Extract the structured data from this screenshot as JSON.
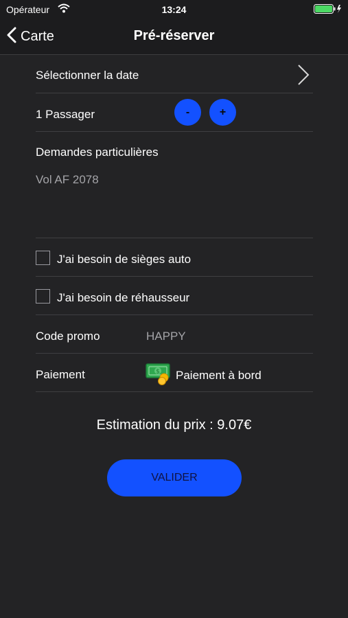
{
  "status_bar": {
    "carrier": "Opérateur",
    "time": "13:24"
  },
  "nav": {
    "back_label": "Carte",
    "title": "Pré-réserver"
  },
  "form": {
    "date_label": "Sélectionner la date",
    "passenger_label": "1 Passager",
    "minus_label": "-",
    "plus_label": "+",
    "requests_label": "Demandes particulières",
    "requests_text": "Vol AF 2078",
    "car_seats_label": "J'ai besoin de sièges auto",
    "car_seats_checked": false,
    "booster_label": "J'ai besoin de réhausseur",
    "booster_checked": false,
    "promo_label": "Code promo",
    "promo_value": "HAPPY",
    "payment_label": "Paiement",
    "payment_value": "Paiement à bord"
  },
  "estimate_text": "Estimation du prix : 9.07€",
  "validate_label": "VALIDER",
  "colors": {
    "background": "#232325",
    "accent": "#1351ff",
    "battery": "#4cd964"
  },
  "icons": [
    "wifi-icon",
    "battery-icon",
    "chevron-left-icon",
    "chevron-right-icon",
    "cash-coins-icon"
  ]
}
